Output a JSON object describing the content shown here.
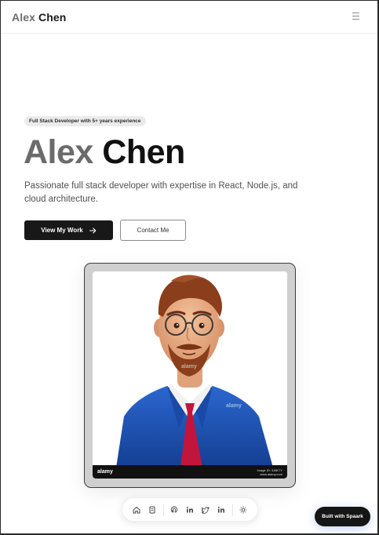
{
  "header": {
    "brand_first": "Alex",
    "brand_last": "Chen",
    "menu_icon": "hamburger-menu-icon"
  },
  "hero": {
    "badge": "Full Stack Developer with 5+ years experience",
    "name_first": "Alex",
    "name_last": "Chen",
    "tagline": "Passionate full stack developer with expertise in React, Node.js, and cloud architecture.",
    "primary_button": "View My Work",
    "primary_button_icon": "arrow-right-icon",
    "secondary_button": "Contact Me"
  },
  "portrait": {
    "watermark": "alamy",
    "stock_logo": "alamy",
    "image_id": "Image ID: 3J8K7Y",
    "site": "www.alamy.com"
  },
  "dock": {
    "items": [
      {
        "icon": "home-icon"
      },
      {
        "icon": "document-icon"
      },
      {
        "icon": "github-icon"
      },
      {
        "icon": "linkedin-icon"
      },
      {
        "icon": "twitter-icon"
      },
      {
        "icon": "linkedin-icon"
      },
      {
        "icon": "sun-icon"
      }
    ]
  },
  "footer_badge": "Built with Spaark",
  "colors": {
    "accent": "#181818",
    "muted_name": "#6b6b6b",
    "suit_blue": "#1f55b8",
    "tie_red": "#c2153c",
    "hair": "#8a3e1c"
  }
}
